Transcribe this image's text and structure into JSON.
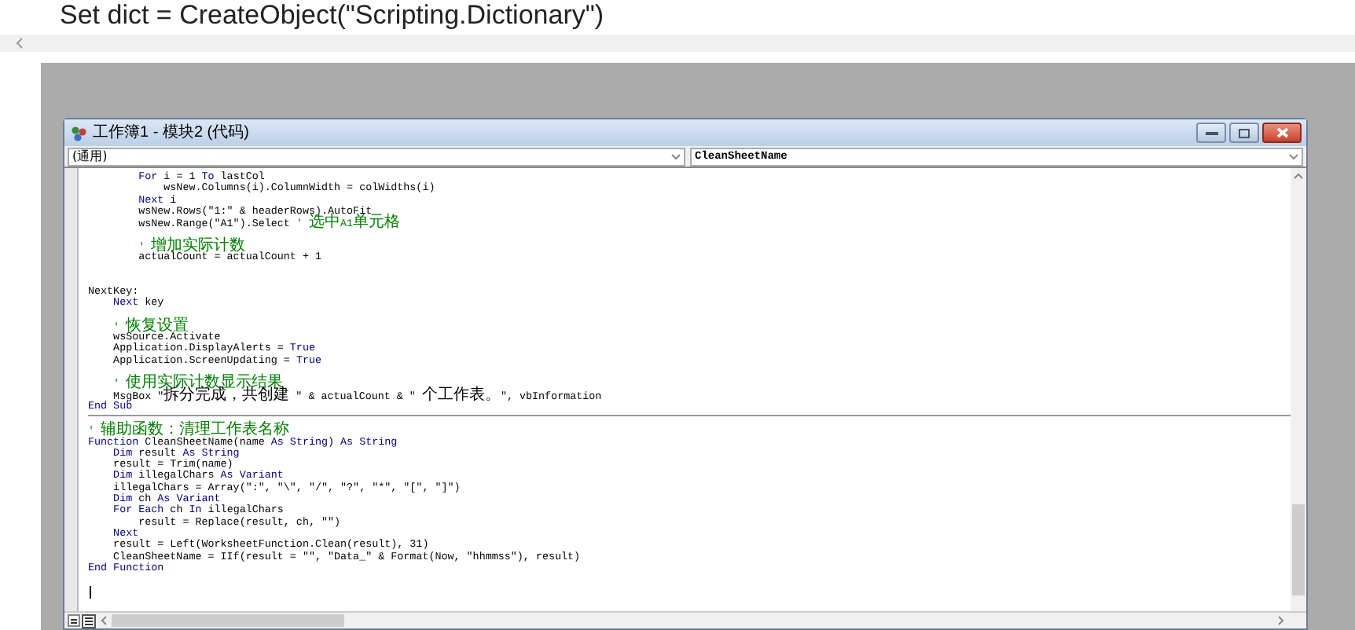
{
  "background_text": "Set dict = CreateObject(\"Scripting.Dictionary\")",
  "window": {
    "title": "工作簿1 - 模块2 (代码)",
    "object_dropdown": "(通用)",
    "procedure_dropdown": "CleanSheetName"
  },
  "code": {
    "procedures": [
      {
        "lines": [
          {
            "kind": "code",
            "segments": [
              {
                "text": "        For",
                "kind": "keyword"
              },
              {
                "text": " i = 1 ",
                "kind": "plain"
              },
              {
                "text": "To",
                "kind": "keyword"
              },
              {
                "text": " lastCol",
                "kind": "plain"
              }
            ]
          },
          {
            "kind": "code",
            "segments": [
              {
                "text": "            wsNew.Columns(i).ColumnWidth = colWidths(i)",
                "kind": "plain"
              }
            ]
          },
          {
            "kind": "code",
            "segments": [
              {
                "text": "        Next",
                "kind": "keyword"
              },
              {
                "text": " i",
                "kind": "plain"
              }
            ]
          },
          {
            "kind": "code",
            "segments": [
              {
                "text": "        wsNew.Rows(\"1:\" & headerRows).AutoFit",
                "kind": "plain"
              }
            ]
          },
          {
            "kind": "code",
            "segments": [
              {
                "text": "        wsNew.Range(\"A1\").Select ",
                "kind": "plain"
              },
              {
                "text": "' 选中A1单元格",
                "kind": "comment"
              }
            ]
          },
          {
            "kind": "blank"
          },
          {
            "kind": "code",
            "segments": [
              {
                "text": "        ' 增加实际计数",
                "kind": "comment"
              }
            ]
          },
          {
            "kind": "code",
            "segments": [
              {
                "text": "        actualCount = actualCount + 1",
                "kind": "plain"
              }
            ]
          },
          {
            "kind": "blank"
          },
          {
            "kind": "blank"
          },
          {
            "kind": "code",
            "segments": [
              {
                "text": "NextKey:",
                "kind": "plain"
              }
            ]
          },
          {
            "kind": "code",
            "segments": [
              {
                "text": "    Next",
                "kind": "keyword"
              },
              {
                "text": " key",
                "kind": "plain"
              }
            ]
          },
          {
            "kind": "blank"
          },
          {
            "kind": "code",
            "segments": [
              {
                "text": "    ' 恢复设置",
                "kind": "comment"
              }
            ]
          },
          {
            "kind": "code",
            "segments": [
              {
                "text": "    wsSource.Activate",
                "kind": "plain"
              }
            ]
          },
          {
            "kind": "code",
            "segments": [
              {
                "text": "    Application.DisplayAlerts = ",
                "kind": "plain"
              },
              {
                "text": "True",
                "kind": "keyword"
              }
            ]
          },
          {
            "kind": "code",
            "segments": [
              {
                "text": "    Application.ScreenUpdating = ",
                "kind": "plain"
              },
              {
                "text": "True",
                "kind": "keyword"
              }
            ]
          },
          {
            "kind": "blank"
          },
          {
            "kind": "code",
            "segments": [
              {
                "text": "    ' 使用实际计数显示结果",
                "kind": "comment"
              }
            ]
          },
          {
            "kind": "code",
            "segments": [
              {
                "text": "    MsgBox \"拆分完成，共创建 \" & actualCount & \" 个工作表。\", vbInformation",
                "kind": "plain"
              }
            ]
          },
          {
            "kind": "code",
            "segments": [
              {
                "text": "End Sub",
                "kind": "keyword"
              }
            ]
          }
        ]
      },
      {
        "lines": [
          {
            "kind": "code",
            "segments": [
              {
                "text": "' 辅助函数：清理工作表名称",
                "kind": "comment"
              }
            ]
          },
          {
            "kind": "code",
            "segments": [
              {
                "text": "Function",
                "kind": "keyword"
              },
              {
                "text": " CleanSheetName(name ",
                "kind": "plain"
              },
              {
                "text": "As String",
                "kind": "keyword"
              },
              {
                "text": ") ",
                "kind": "plain"
              },
              {
                "text": "As String",
                "kind": "keyword"
              }
            ]
          },
          {
            "kind": "code",
            "segments": [
              {
                "text": "    Dim",
                "kind": "keyword"
              },
              {
                "text": " result ",
                "kind": "plain"
              },
              {
                "text": "As String",
                "kind": "keyword"
              }
            ]
          },
          {
            "kind": "code",
            "segments": [
              {
                "text": "    result = Trim(name)",
                "kind": "plain"
              }
            ]
          },
          {
            "kind": "code",
            "segments": [
              {
                "text": "    Dim",
                "kind": "keyword"
              },
              {
                "text": " illegalChars ",
                "kind": "plain"
              },
              {
                "text": "As Variant",
                "kind": "keyword"
              }
            ]
          },
          {
            "kind": "code",
            "segments": [
              {
                "text": "    illegalChars = Array(\":\", \"\\\", \"/\", \"?\", \"*\", \"[\", \"]\")",
                "kind": "plain"
              }
            ]
          },
          {
            "kind": "code",
            "segments": [
              {
                "text": "    Dim",
                "kind": "keyword"
              },
              {
                "text": " ch ",
                "kind": "plain"
              },
              {
                "text": "As Variant",
                "kind": "keyword"
              }
            ]
          },
          {
            "kind": "code",
            "segments": [
              {
                "text": "    For Each",
                "kind": "keyword"
              },
              {
                "text": " ch ",
                "kind": "plain"
              },
              {
                "text": "In",
                "kind": "keyword"
              },
              {
                "text": " illegalChars",
                "kind": "plain"
              }
            ]
          },
          {
            "kind": "code",
            "segments": [
              {
                "text": "        result = Replace(result, ch, \"\")",
                "kind": "plain"
              }
            ]
          },
          {
            "kind": "code",
            "segments": [
              {
                "text": "    Next",
                "kind": "keyword"
              }
            ]
          },
          {
            "kind": "code",
            "segments": [
              {
                "text": "    result = Left(WorksheetFunction.Clean(result), 31)",
                "kind": "plain"
              }
            ]
          },
          {
            "kind": "code",
            "segments": [
              {
                "text": "    CleanSheetName = IIf(result = \"\", \"Data_\" & Format(Now, \"hhmmss\"), result)",
                "kind": "plain"
              }
            ]
          },
          {
            "kind": "code",
            "segments": [
              {
                "text": "End Function",
                "kind": "keyword"
              }
            ]
          },
          {
            "kind": "blank"
          },
          {
            "kind": "cursor"
          }
        ]
      }
    ]
  }
}
